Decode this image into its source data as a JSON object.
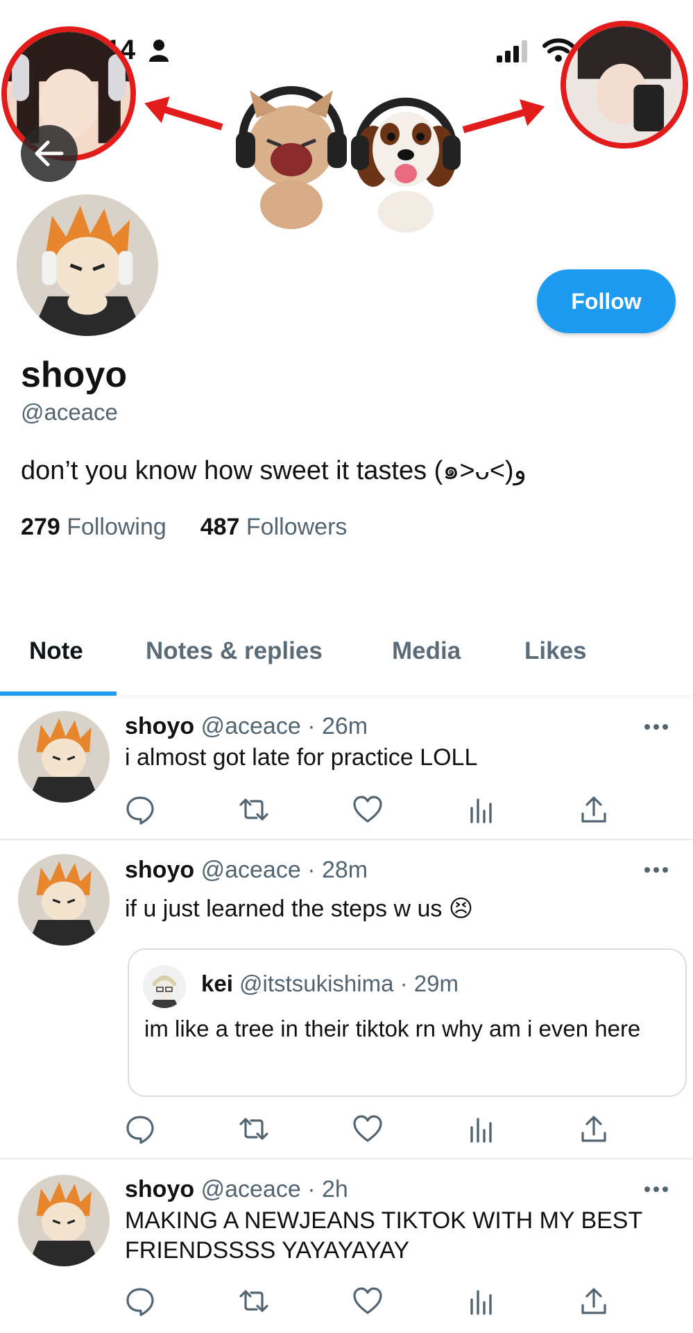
{
  "status_bar": {
    "time": "9:14"
  },
  "profile": {
    "display_name": "shoyo",
    "handle": "@aceace",
    "bio": "don’t you know how sweet it tastes (๑˃ᴗ˂)ﻭ",
    "following_count": "279",
    "following_label": "Following",
    "followers_count": "487",
    "followers_label": "Followers",
    "follow_label": "Follow"
  },
  "tabs": [
    {
      "label": "Note",
      "active": true
    },
    {
      "label": "Notes & replies",
      "active": false
    },
    {
      "label": "Media",
      "active": false
    },
    {
      "label": "Likes",
      "active": false
    }
  ],
  "posts": [
    {
      "name": "shoyo",
      "handle": "@aceace",
      "time": "· 26m",
      "text": "i almost got late for practice LOLL"
    },
    {
      "name": "shoyo",
      "handle": "@aceace",
      "time": "· 28m",
      "text": "if u just learned the steps w us 😣",
      "quote": {
        "name": "kei",
        "handle": "@itstsukishima",
        "time": "· 29m",
        "text": "im like a tree in their tiktok rn why am i even here"
      }
    },
    {
      "name": "shoyo",
      "handle": "@aceace",
      "time": "· 2h",
      "text": "MAKING A NEWJEANS TIKTOK WITH MY BEST FRIENDSSSS YAYAYAYAY"
    }
  ],
  "icons": [
    "person-icon",
    "signal-icon",
    "wifi-icon",
    "back-arrow-icon",
    "more-icon",
    "reply-icon",
    "retweet-icon",
    "like-icon",
    "views-icon",
    "share-icon"
  ],
  "colors": {
    "accent": "#1d9bf0",
    "annotation_red": "#e21b1b",
    "secondary_text": "#536471"
  }
}
